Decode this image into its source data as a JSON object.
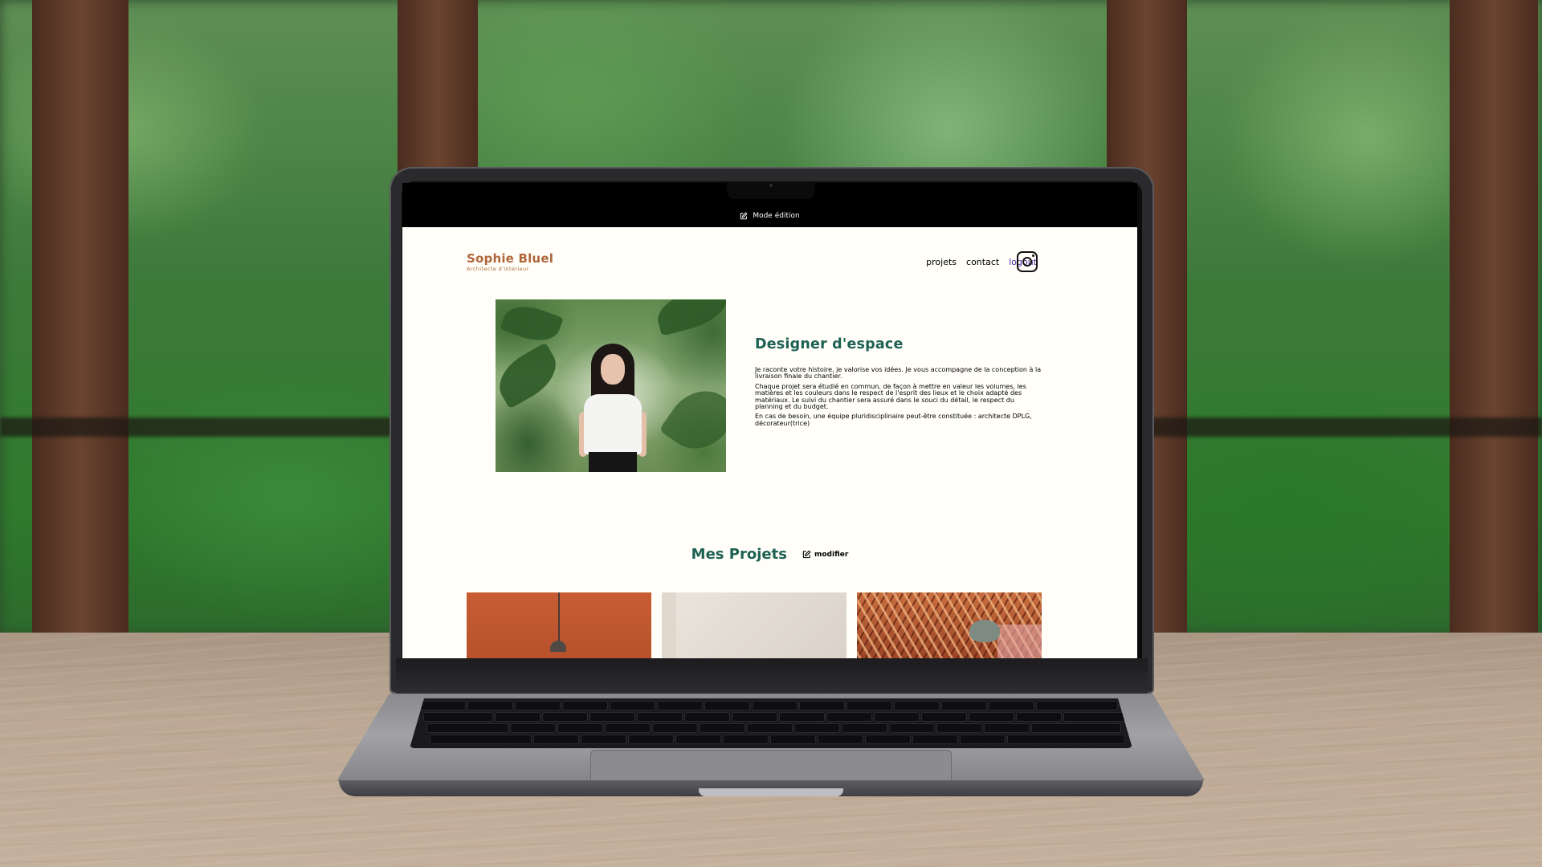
{
  "edit_bar": {
    "icon": "pen-square-icon",
    "label": "Mode édition"
  },
  "header": {
    "brand_name": "Sophie Bluel",
    "brand_subtitle": "Architecte d'intérieur",
    "nav": [
      {
        "label": "projets"
      },
      {
        "label": "contact"
      },
      {
        "label": "logout",
        "active": true
      }
    ],
    "instagram_icon": "instagram-icon"
  },
  "intro": {
    "title": "Designer d'espace",
    "paragraphs": [
      "Je raconte votre histoire, je valorise vos idées. Je vous accompagne de la conception à la livraison finale du chantier.",
      "Chaque projet sera étudié en commun, de façon à mettre en valeur les volumes, les matières et les couleurs dans le respect de l'esprit des lieux et le choix adapté des matériaux. Le suivi du chantier sera assuré dans le souci du détail, le respect du planning et du budget.",
      "En cas de besoin, une équipe pluridisciplinaire peut-être constituée : architecte DPLG, décorateur(trice)"
    ]
  },
  "projects": {
    "title": "Mes Projets",
    "edit_label": "modifier",
    "edit_icon": "pen-square-icon"
  },
  "colors": {
    "brand": "#b1663c",
    "heading": "#1d6154",
    "active_nav": "#4c2ba1",
    "edit_bar_bg": "#000000",
    "page_bg": "#fffef8"
  }
}
